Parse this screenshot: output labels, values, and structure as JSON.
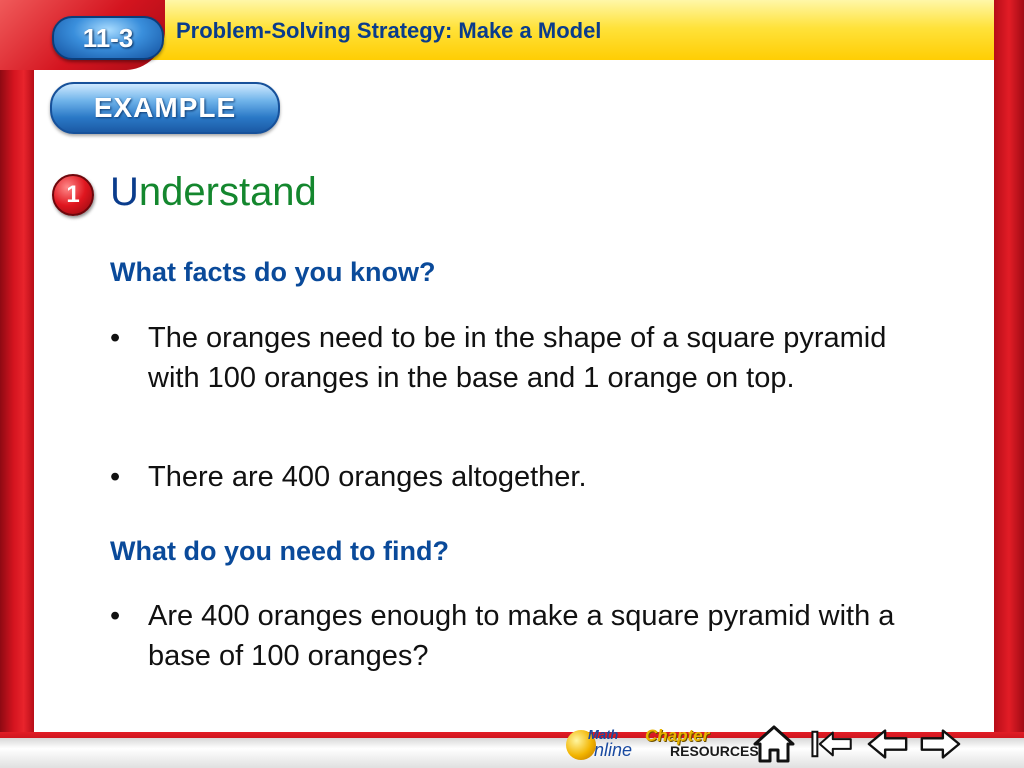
{
  "header": {
    "lesson": "11-3",
    "title": "Problem-Solving Strategy: Make a Model"
  },
  "example_label": "EXAMPLE",
  "step": {
    "number": "1",
    "title_first": "U",
    "title_rest": "nderstand"
  },
  "sections": [
    {
      "question": "What facts do you know?",
      "bullets": [
        "The oranges need to be in the shape of a square pyramid with 100 oranges in the base and 1 orange on top.",
        "There are 400 oranges altogether."
      ]
    },
    {
      "question": "What do you need to find?",
      "bullets": [
        "Are 400 oranges enough to make a square pyramid with a base of 100 oranges?"
      ]
    }
  ],
  "bullet_char": "•",
  "footer": {
    "math_label": "Math",
    "online_label": "nline",
    "chapter_label": "Chapter",
    "resources_label": "RESOURCES",
    "icons": [
      "home-icon",
      "first-slide-icon",
      "previous-slide-icon",
      "next-slide-icon"
    ]
  },
  "colors": {
    "frame_red": "#d4141f",
    "header_yellow": "#ffe23a",
    "heading_blue": "#0a4a9a",
    "step_green": "#14872e"
  }
}
